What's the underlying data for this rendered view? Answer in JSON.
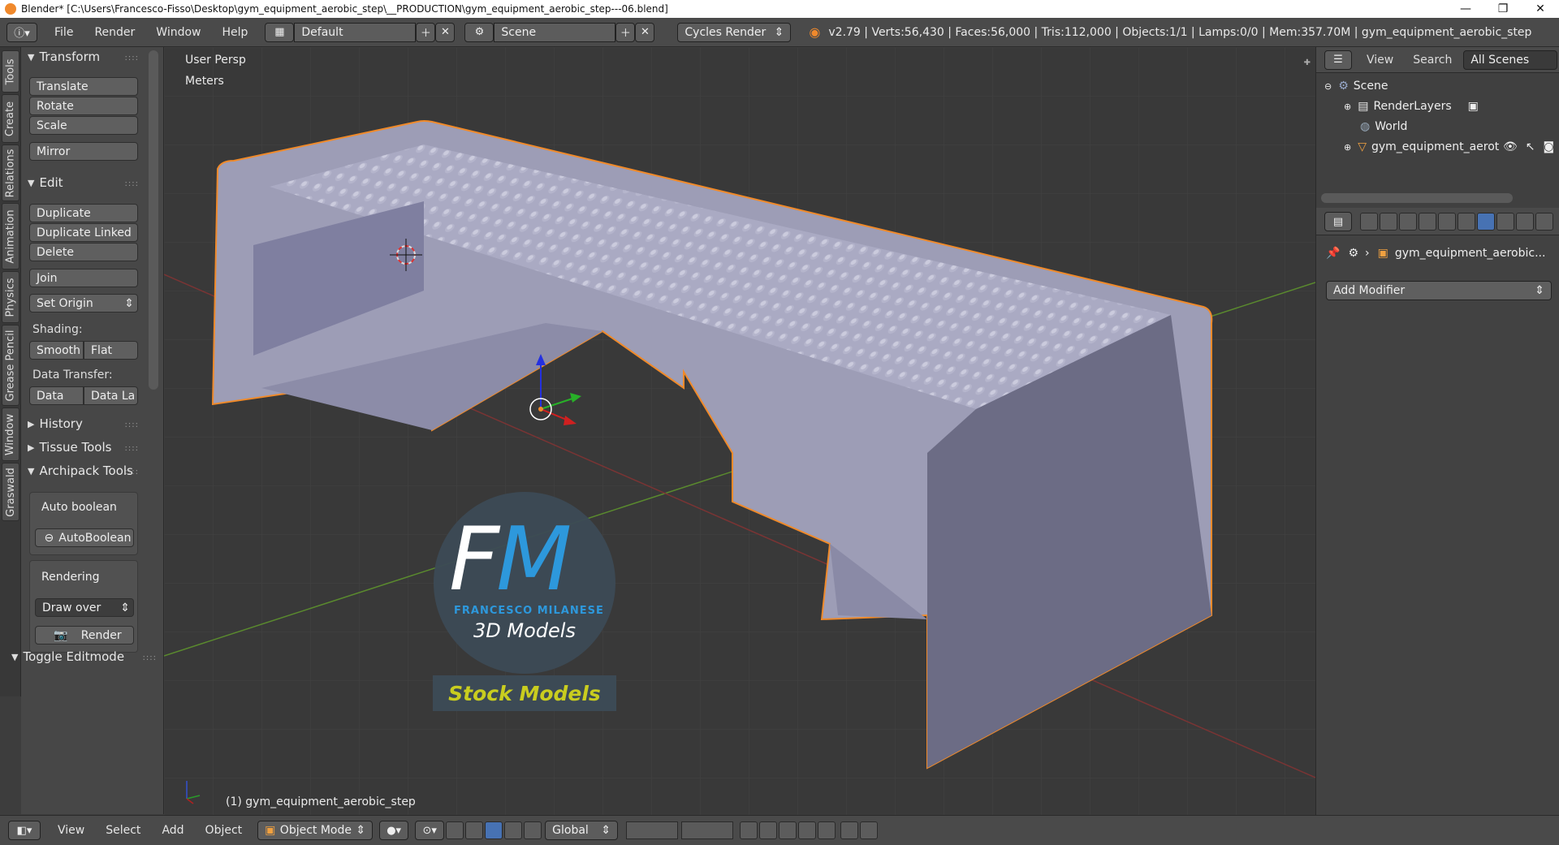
{
  "window": {
    "title": "Blender* [C:\\Users\\Francesco-Fisso\\Desktop\\gym_equipment_aerobic_step\\__PRODUCTION\\gym_equipment_aerobic_step---06.blend]",
    "controls": [
      "—",
      "❐",
      "✕"
    ]
  },
  "info_header": {
    "menus": [
      "File",
      "Render",
      "Window",
      "Help"
    ],
    "layout": "Default",
    "scene": "Scene",
    "engine": "Cycles Render",
    "stats": "v2.79 | Verts:56,430 | Faces:56,000 | Tris:112,000 | Objects:1/1 | Lamps:0/0 | Mem:357.70M | gym_equipment_aerobic_step"
  },
  "tool_tabs": [
    "Tools",
    "Create",
    "Relations",
    "Animation",
    "Physics",
    "Grease Pencil",
    "Window",
    "Graswald"
  ],
  "tool_shelf": {
    "transform": {
      "title": "Transform",
      "buttons": [
        "Translate",
        "Rotate",
        "Scale",
        "Mirror"
      ]
    },
    "edit": {
      "title": "Edit",
      "buttons": [
        "Duplicate",
        "Duplicate Linked",
        "Delete",
        "Join"
      ],
      "set_origin": "Set Origin",
      "shading_label": "Shading:",
      "shading": [
        "Smooth",
        "Flat"
      ],
      "data_transfer_label": "Data Transfer:",
      "data_transfer": [
        "Data",
        "Data La"
      ]
    },
    "history": "History",
    "tissue": "Tissue Tools",
    "archipack": {
      "title": "Archipack Tools",
      "auto_boolean_label": "Auto boolean",
      "auto_boolean_btn": "AutoBoolean",
      "rendering_label": "Rendering",
      "draw_over": "Draw over",
      "render_btn": "Render"
    },
    "toggle_editmode": "Toggle Editmode"
  },
  "viewport": {
    "view_name": "User Persp",
    "units": "Meters",
    "object_label": "(1) gym_equipment_aerobic_step",
    "watermark": {
      "f": "F",
      "m": "M",
      "name": "FRANCESCO MILANESE",
      "models": "3D Models",
      "stock": "Stock Models"
    }
  },
  "outliner": {
    "menus": [
      "View",
      "Search"
    ],
    "filter": "All Scenes",
    "rows": [
      "Scene",
      "RenderLayers",
      "World",
      "gym_equipment_aerot"
    ]
  },
  "properties": {
    "object_name": "gym_equipment_aerobic...",
    "add_modifier": "Add Modifier"
  },
  "bottom_header": {
    "menus": [
      "View",
      "Select",
      "Add",
      "Object"
    ],
    "mode": "Object Mode",
    "orientation": "Global"
  },
  "colors": {
    "accent_selected": "#4772b3",
    "object_outline": "#f08a2a",
    "mesh": "#a9a9c2"
  }
}
